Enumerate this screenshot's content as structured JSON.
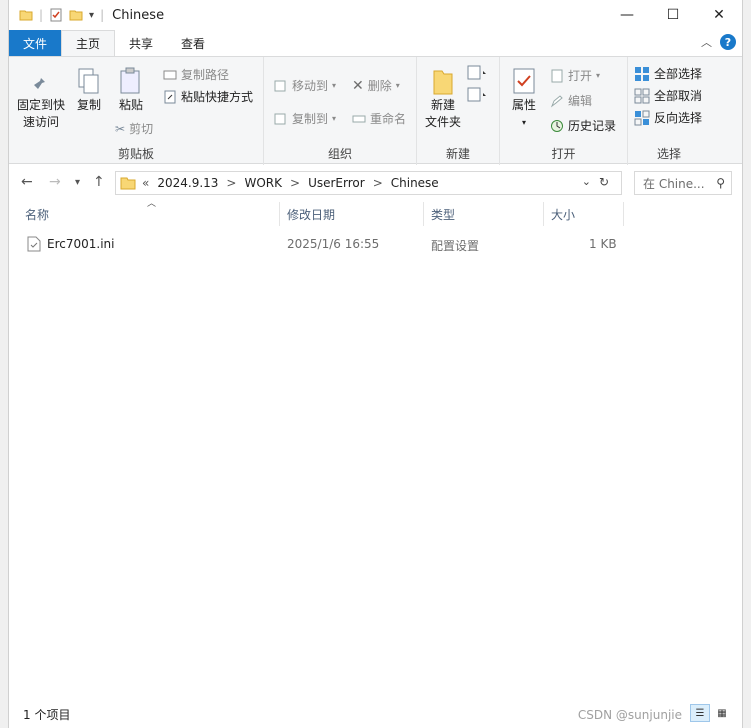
{
  "window": {
    "title": "Chinese"
  },
  "title_controls": {
    "minimize": "—",
    "maximize": "☐",
    "close": "✕"
  },
  "tabs": [
    {
      "label": "文件"
    },
    {
      "label": "主页"
    },
    {
      "label": "共享"
    },
    {
      "label": "查看"
    }
  ],
  "ribbon": {
    "clipboard": {
      "pin_label_1": "固定到快",
      "pin_label_2": "速访问",
      "copy": "复制",
      "paste": "粘贴",
      "copy_path": "复制路径",
      "paste_shortcut": "粘贴快捷方式",
      "cut": "剪切",
      "group": "剪贴板"
    },
    "organize": {
      "move_to": "移动到",
      "copy_to": "复制到",
      "delete": "删除",
      "rename": "重命名",
      "group": "组织"
    },
    "new": {
      "folder_1": "新建",
      "folder_2": "文件夹",
      "group": "新建"
    },
    "open": {
      "properties": "属性",
      "open": "打开",
      "edit": "编辑",
      "history": "历史记录",
      "group": "打开"
    },
    "select": {
      "select_all": "全部选择",
      "select_none": "全部取消",
      "invert": "反向选择",
      "group": "选择"
    }
  },
  "nav": {
    "breadcrumb": [
      "«",
      "2024.9.13",
      ">",
      "WORK",
      ">",
      "UserError",
      ">",
      "Chinese"
    ],
    "search_placeholder": "在 Chine..."
  },
  "columns": [
    "名称",
    "修改日期",
    "类型",
    "大小"
  ],
  "files": [
    {
      "name": "Erc7001.ini",
      "modified": "2025/1/6 16:55",
      "type": "配置设置",
      "size": "1 KB"
    }
  ],
  "status": {
    "count": "1 个项目"
  },
  "watermark": "CSDN @sunjunjie"
}
